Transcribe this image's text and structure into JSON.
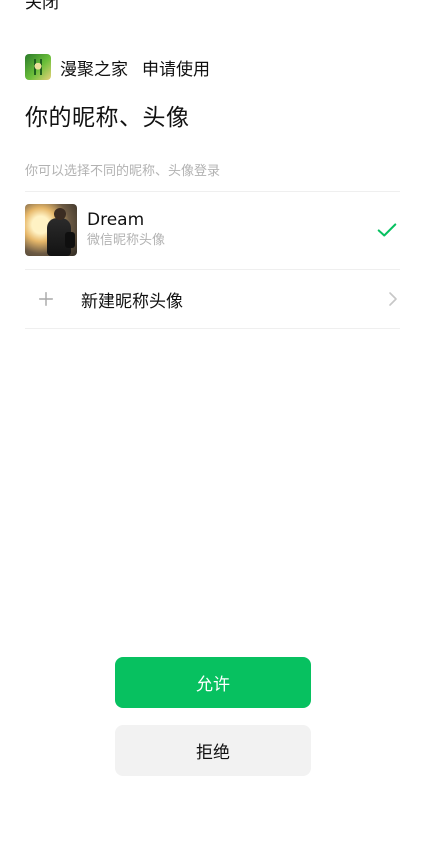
{
  "top_bar": {
    "close_label": "关闭"
  },
  "app": {
    "name": "漫聚之家",
    "request_text": "申请使用"
  },
  "title": "你的昵称、头像",
  "subtitle": "你可以选择不同的昵称、头像登录",
  "options": {
    "current": {
      "name": "Dream",
      "description": "微信昵称头像",
      "selected": true
    },
    "new": {
      "label": "新建昵称头像"
    }
  },
  "buttons": {
    "allow": "允许",
    "deny": "拒绝"
  },
  "colors": {
    "accent": "#07c160",
    "secondary_button_bg": "#f2f2f2",
    "muted_text": "#b2b2b2"
  },
  "icons": {
    "close": "close-icon",
    "app_logo": "app-logo-icon",
    "check": "check-icon",
    "plus": "plus-icon",
    "chevron": "chevron-right-icon"
  }
}
